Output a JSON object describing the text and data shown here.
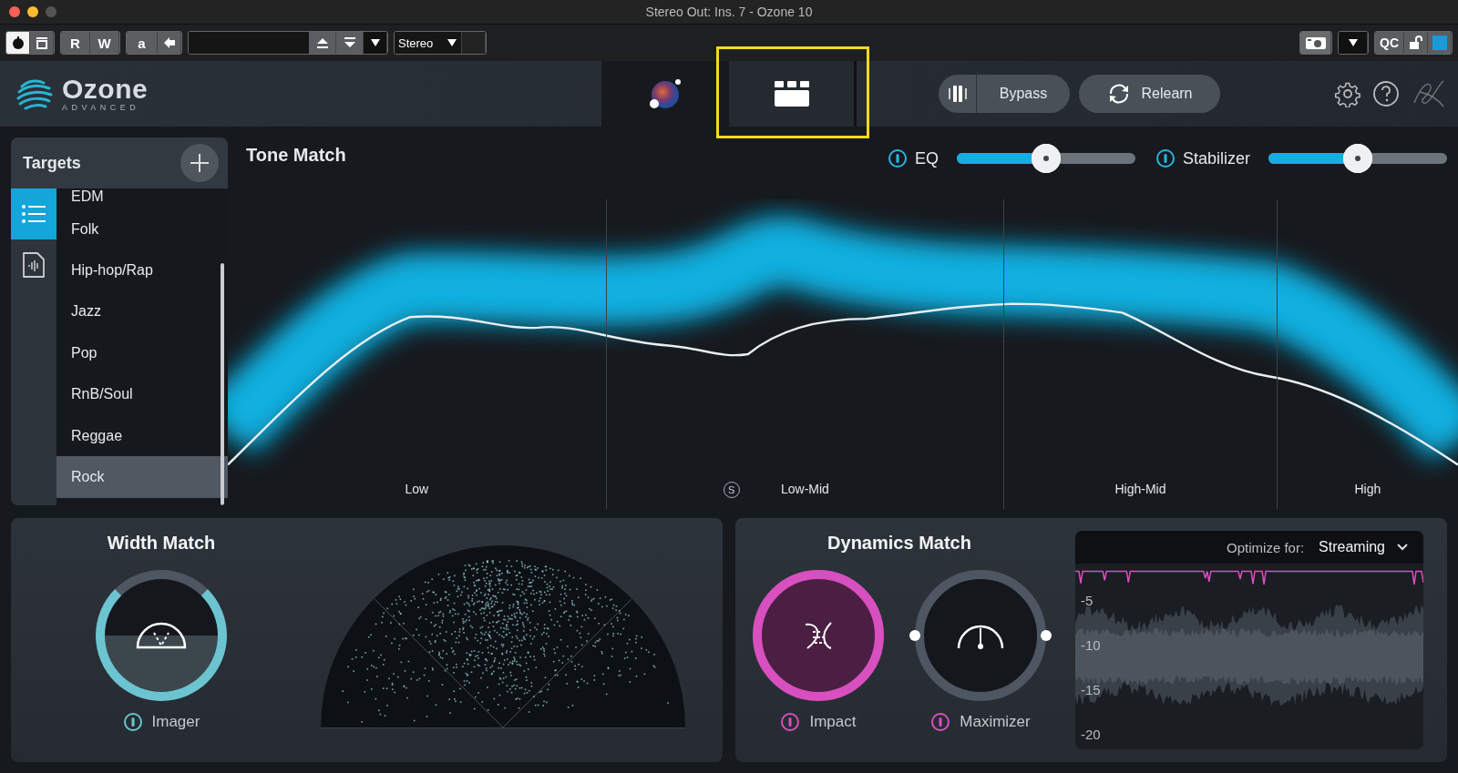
{
  "window": {
    "title": "Stereo Out: Ins. 7 - Ozone 10"
  },
  "toolbar": {
    "buttons": [
      "R",
      "W",
      "a"
    ],
    "channel": "Stereo",
    "qc": "QC"
  },
  "header": {
    "logo": {
      "name": "Ozone",
      "edition": "ADVANCED"
    },
    "bypass": "Bypass",
    "relearn": "Relearn"
  },
  "targets": {
    "title": "Targets",
    "source_tabs": [
      {
        "kind": "list",
        "selected": true
      },
      {
        "kind": "file",
        "selected": false
      }
    ],
    "items": [
      {
        "label": "EDM",
        "selected": false
      },
      {
        "label": "Folk",
        "selected": false
      },
      {
        "label": "Hip-hop/Rap",
        "selected": false
      },
      {
        "label": "Jazz",
        "selected": false
      },
      {
        "label": "Pop",
        "selected": false
      },
      {
        "label": "RnB/Soul",
        "selected": false
      },
      {
        "label": "Reggae",
        "selected": false
      },
      {
        "label": "Rock",
        "selected": true
      }
    ]
  },
  "tone_match": {
    "title": "Tone Match",
    "controls": [
      {
        "label": "EQ",
        "on": true,
        "level": 0.5
      },
      {
        "label": "Stabilizer",
        "on": true,
        "level": 0.5
      }
    ],
    "solo": "S",
    "bands": [
      "Low",
      "Low-Mid",
      "High-Mid",
      "High"
    ]
  },
  "width_match": {
    "title": "Width Match",
    "module": {
      "label": "Imager",
      "on": true
    }
  },
  "dynamics_match": {
    "title": "Dynamics Match",
    "modules": [
      {
        "kind": "impact",
        "label": "Impact",
        "on": true
      },
      {
        "kind": "maximizer",
        "label": "Maximizer",
        "on": true
      }
    ],
    "optimize_label": "Optimize for:",
    "optimize_value": "Streaming",
    "scale": [
      "-5",
      "-10",
      "-15",
      "-20"
    ]
  }
}
